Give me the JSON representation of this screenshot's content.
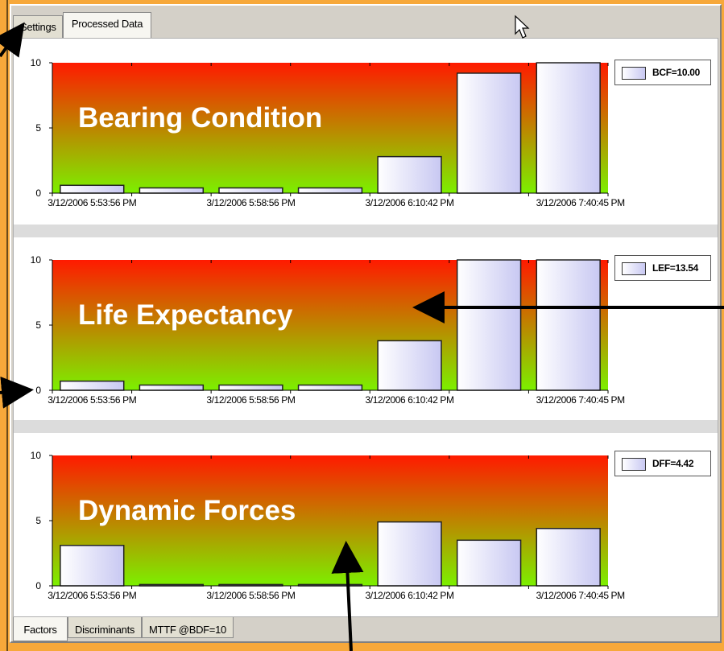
{
  "tabs_top": [
    {
      "label": "Settings",
      "active": false
    },
    {
      "label": "Processed Data",
      "active": true
    }
  ],
  "tabs_bottom": [
    {
      "label": "Factors",
      "active": true
    },
    {
      "label": "Discriminants",
      "active": false
    },
    {
      "label": "MTTF @BDF=10",
      "active": false
    }
  ],
  "colors": {
    "gradient_top": "#ff1a00",
    "gradient_bottom": "#7cf000",
    "bar_fill_left": "#ffffff",
    "bar_fill_right": "#c8c8f2",
    "window_bg": "#d4d0c8",
    "outer_bg": "#f7a83a"
  },
  "chart_data": [
    {
      "type": "bar",
      "title": "Bearing Condition",
      "categories": [
        "3/12/2006 5:53:56 PM",
        "",
        "3/12/2006 5:58:56 PM",
        "",
        "3/12/2006 6:10:42 PM",
        "",
        "3/12/2006 7:40:45 PM"
      ],
      "x_tick_labels": [
        "3/12/2006 5:53:56 PM",
        "3/12/2006 5:58:56 PM",
        "3/12/2006 6:10:42 PM",
        "3/12/2006 7:40:45 PM"
      ],
      "y_tick_labels": [
        "10",
        "5",
        "0"
      ],
      "values": [
        0.6,
        0.4,
        0.4,
        0.4,
        2.8,
        9.2,
        10
      ],
      "ylim": [
        0,
        10
      ],
      "legend": "BCF=10.00"
    },
    {
      "type": "bar",
      "title": "Life Expectancy",
      "categories": [
        "3/12/2006 5:53:56 PM",
        "",
        "3/12/2006 5:58:56 PM",
        "",
        "3/12/2006 6:10:42 PM",
        "",
        "3/12/2006 7:40:45 PM"
      ],
      "x_tick_labels": [
        "3/12/2006 5:53:56 PM",
        "3/12/2006 5:58:56 PM",
        "3/12/2006 6:10:42 PM",
        "3/12/2006 7:40:45 PM"
      ],
      "y_tick_labels": [
        "10",
        "5",
        "0"
      ],
      "values": [
        0.7,
        0.4,
        0.4,
        0.4,
        3.8,
        10,
        10
      ],
      "ylim": [
        0,
        10
      ],
      "legend": "LEF=13.54"
    },
    {
      "type": "bar",
      "title": "Dynamic Forces",
      "categories": [
        "3/12/2006 5:53:56 PM",
        "",
        "3/12/2006 5:58:56 PM",
        "",
        "3/12/2006 6:10:42 PM",
        "",
        "3/12/2006 7:40:45 PM"
      ],
      "x_tick_labels": [
        "3/12/2006 5:53:56 PM",
        "3/12/2006 5:58:56 PM",
        "3/12/2006 6:10:42 PM",
        "3/12/2006 7:40:45 PM"
      ],
      "y_tick_labels": [
        "10",
        "5",
        "0"
      ],
      "values": [
        3.1,
        0.1,
        0.1,
        0.1,
        4.9,
        3.5,
        4.4
      ],
      "ylim": [
        0,
        10
      ],
      "legend": "DFF=4.42"
    }
  ]
}
